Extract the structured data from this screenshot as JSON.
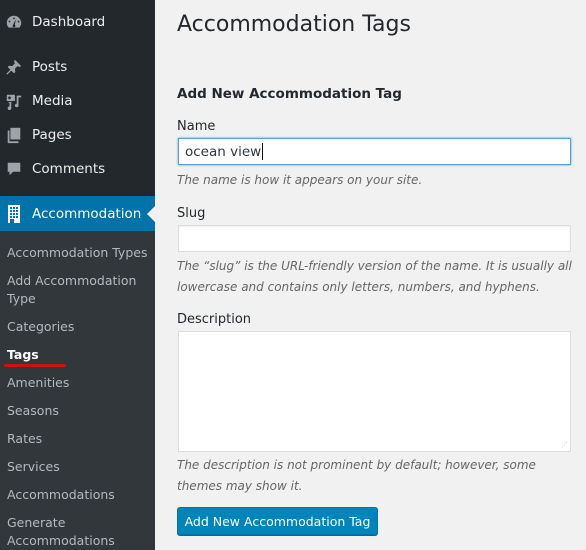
{
  "sidebar": {
    "items": [
      {
        "label": "Dashboard",
        "icon": "dashboard-icon"
      },
      {
        "label": "Posts",
        "icon": "pin-icon"
      },
      {
        "label": "Media",
        "icon": "media-icon"
      },
      {
        "label": "Pages",
        "icon": "pages-icon"
      },
      {
        "label": "Comments",
        "icon": "comment-icon"
      },
      {
        "label": "Accommodation",
        "icon": "building-icon",
        "active": true
      }
    ],
    "submenu": [
      {
        "label": "Accommodation Types"
      },
      {
        "label": "Add Accommodation Type"
      },
      {
        "label": "Categories"
      },
      {
        "label": "Tags",
        "current": true
      },
      {
        "label": "Amenities"
      },
      {
        "label": "Seasons"
      },
      {
        "label": "Rates"
      },
      {
        "label": "Services"
      },
      {
        "label": "Accommodations"
      },
      {
        "label": "Generate Accommodations"
      }
    ]
  },
  "page": {
    "title": "Accommodation Tags",
    "form_heading": "Add New Accommodation Tag",
    "fields": {
      "name": {
        "label": "Name",
        "value": "ocean view",
        "help": "The name is how it appears on your site."
      },
      "slug": {
        "label": "Slug",
        "value": "",
        "help": "The “slug” is the URL-friendly version of the name. It is usually all lowercase and contains only letters, numbers, and hyphens."
      },
      "description": {
        "label": "Description",
        "value": "",
        "help": "The description is not prominent by default; however, some themes may show it."
      }
    },
    "submit_label": "Add New Accommodation Tag"
  },
  "colors": {
    "sidebar_bg": "#23282d",
    "submenu_bg": "#32373c",
    "accent": "#0073aa",
    "button": "#0085ba",
    "annotation": "#d01010"
  }
}
